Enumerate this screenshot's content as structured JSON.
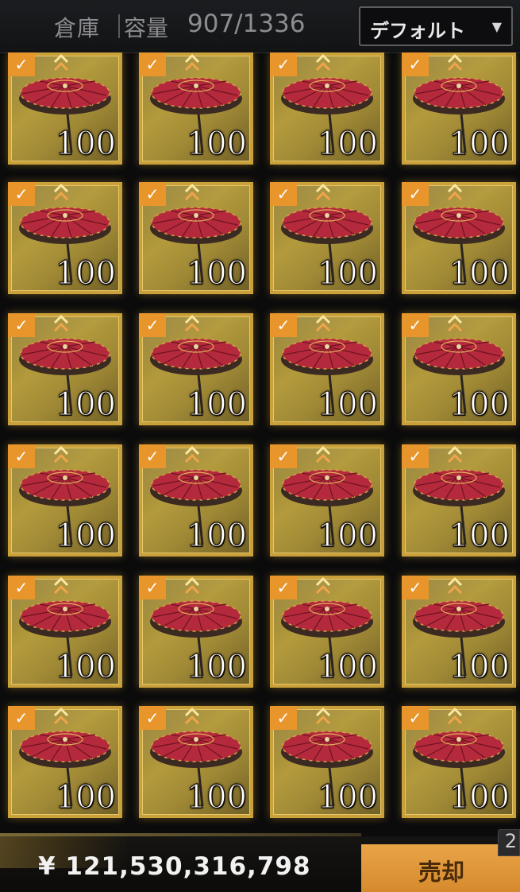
{
  "header": {
    "title": "倉庫",
    "capacity_label": "容量",
    "capacity_value": "907/1336",
    "sort_label": "デフォルト",
    "sort_caret_icon": "caret-down-icon"
  },
  "item_grid": {
    "columns": 4,
    "rows": 6,
    "item": {
      "icon": "red-umbrella-icon",
      "quantity": "100",
      "selected": true,
      "rank_icon": "rank-up-chevron-icon"
    }
  },
  "footer": {
    "currency_symbol": "¥",
    "money": "121,530,316,798",
    "sell_label": "売却",
    "badge_value": "2"
  },
  "colors": {
    "accent_orange": "#e8962b",
    "cell_gold": "#c9a03a",
    "umbrella_red": "#b42a3c"
  }
}
